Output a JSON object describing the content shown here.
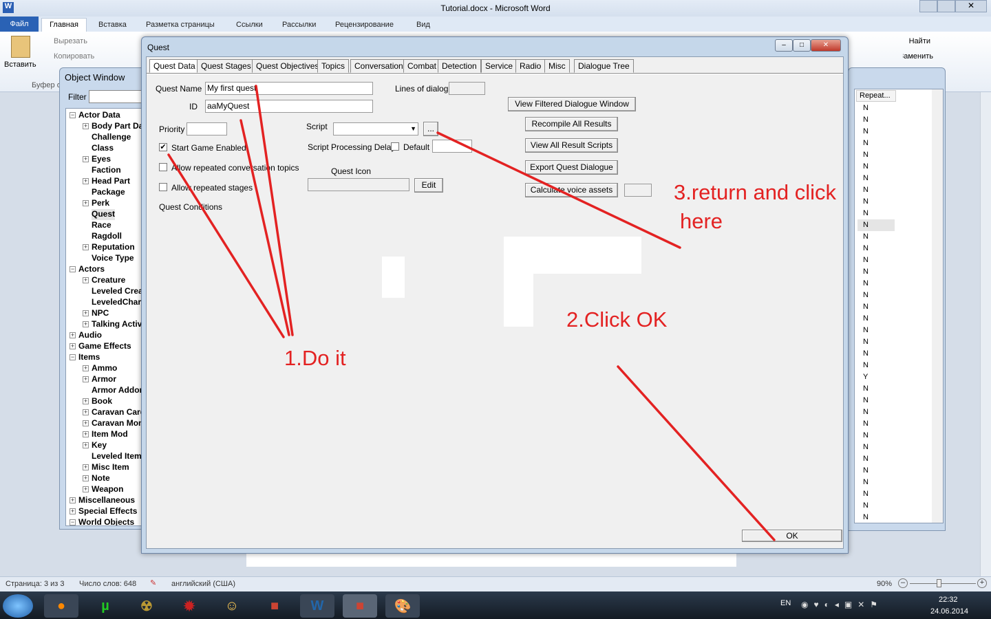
{
  "word": {
    "title": "Tutorial.docx - Microsoft Word",
    "file_tab": "Файл",
    "tabs": [
      "Главная",
      "Вставка",
      "Разметка страницы",
      "Ссылки",
      "Рассылки",
      "Рецензирование",
      "Вид"
    ],
    "clipboard": {
      "paste": "Вставить",
      "cut": "Вырезать",
      "copy": "Копировать",
      "group": "Буфер обмена"
    },
    "find": "Найти",
    "replace": "Заменить",
    "status": {
      "page": "Страница: 3 из 3",
      "words": "Число слов: 648",
      "language": "английский (США)",
      "zoom": "90%"
    }
  },
  "object_window": {
    "title": "Object Window",
    "filter_label": "Filter",
    "tree": [
      {
        "label": "Actor Data",
        "level": 0,
        "expander": "minus"
      },
      {
        "label": "Body Part Data",
        "level": 1,
        "expander": "plus"
      },
      {
        "label": "Challenge",
        "level": 1,
        "expander": ""
      },
      {
        "label": "Class",
        "level": 1,
        "expander": ""
      },
      {
        "label": "Eyes",
        "level": 1,
        "expander": "plus"
      },
      {
        "label": "Faction",
        "level": 1,
        "expander": ""
      },
      {
        "label": "Head Part",
        "level": 1,
        "expander": "plus"
      },
      {
        "label": "Package",
        "level": 1,
        "expander": ""
      },
      {
        "label": "Perk",
        "level": 1,
        "expander": "plus"
      },
      {
        "label": "Quest",
        "level": 1,
        "expander": "",
        "selected": true
      },
      {
        "label": "Race",
        "level": 1,
        "expander": ""
      },
      {
        "label": "Ragdoll",
        "level": 1,
        "expander": ""
      },
      {
        "label": "Reputation",
        "level": 1,
        "expander": "plus"
      },
      {
        "label": "Voice Type",
        "level": 1,
        "expander": ""
      },
      {
        "label": "Actors",
        "level": 0,
        "expander": "minus"
      },
      {
        "label": "Creature",
        "level": 1,
        "expander": "plus"
      },
      {
        "label": "Leveled Creature",
        "level": 1,
        "expander": ""
      },
      {
        "label": "LeveledCharacter",
        "level": 1,
        "expander": ""
      },
      {
        "label": "NPC",
        "level": 1,
        "expander": "plus"
      },
      {
        "label": "Talking Activator",
        "level": 1,
        "expander": "plus"
      },
      {
        "label": "Audio",
        "level": 0,
        "expander": "plus"
      },
      {
        "label": "Game Effects",
        "level": 0,
        "expander": "plus"
      },
      {
        "label": "Items",
        "level": 0,
        "expander": "minus"
      },
      {
        "label": "Ammo",
        "level": 1,
        "expander": "plus"
      },
      {
        "label": "Armor",
        "level": 1,
        "expander": "plus"
      },
      {
        "label": "Armor Addon",
        "level": 1,
        "expander": ""
      },
      {
        "label": "Book",
        "level": 1,
        "expander": "plus"
      },
      {
        "label": "Caravan Card",
        "level": 1,
        "expander": "plus"
      },
      {
        "label": "Caravan Money",
        "level": 1,
        "expander": "plus"
      },
      {
        "label": "Item Mod",
        "level": 1,
        "expander": "plus"
      },
      {
        "label": "Key",
        "level": 1,
        "expander": "plus"
      },
      {
        "label": "Leveled Item",
        "level": 1,
        "expander": ""
      },
      {
        "label": "Misc Item",
        "level": 1,
        "expander": "plus"
      },
      {
        "label": "Note",
        "level": 1,
        "expander": "plus"
      },
      {
        "label": "Weapon",
        "level": 1,
        "expander": "plus"
      },
      {
        "label": "Miscellaneous",
        "level": 0,
        "expander": "plus"
      },
      {
        "label": "Special Effects",
        "level": 0,
        "expander": "plus"
      },
      {
        "label": "World Objects",
        "level": 0,
        "expander": "minus"
      }
    ]
  },
  "right_list": {
    "column": "Repeat...",
    "values": [
      "N",
      "N",
      "N",
      "N",
      "N",
      "N",
      "N",
      "N",
      "N",
      "N",
      "N",
      "N",
      "N",
      "N",
      "N",
      "N",
      "N",
      "N",
      "N",
      "N",
      "N",
      "N",
      "N",
      "Y",
      "N",
      "N",
      "N",
      "N",
      "N",
      "N",
      "N",
      "N",
      "N",
      "N",
      "N",
      "N"
    ]
  },
  "quest": {
    "title": "Quest",
    "tabs": [
      "Quest Data",
      "Quest Stages",
      "Quest Objectives",
      "Topics",
      "Conversation",
      "Combat",
      "Detection",
      "Service",
      "Radio",
      "Misc",
      "Dialogue Tree"
    ],
    "active_tab": "Quest Data",
    "quest_name_label": "Quest Name",
    "quest_name": "My first quest",
    "id_label": "ID",
    "id": "aaMyQuest",
    "priority_label": "Priority",
    "priority": "",
    "start_game_enabled": {
      "label": "Start Game Enabled",
      "checked": true
    },
    "allow_repeated_topics": {
      "label": "Allow repeated conversation topics",
      "checked": false
    },
    "allow_repeated_stages": {
      "label": "Allow repeated stages",
      "checked": false
    },
    "conditions_label": "Quest Conditions",
    "script_label": "Script",
    "script": "",
    "browse": "...",
    "delay_label": "Script Processing Delay",
    "default_label": "Default",
    "default_checked": false,
    "quest_icon_label": "Quest Icon",
    "edit": "Edit",
    "lines_label": "Lines of dialog:",
    "buttons": [
      "View Filtered Dialogue Window",
      "Recompile All Results",
      "View All Result Scripts",
      "Export Quest Dialogue",
      "Calculate voice assets"
    ],
    "ok": "OK"
  },
  "annotations": {
    "step1": "1.Do it",
    "step2": "2.Click OK",
    "step3a": "3.return and click",
    "step3b": "here",
    "color": "#e32222"
  },
  "taskbar": {
    "lang": "EN",
    "time": "22:32",
    "date": "24.06.2014"
  }
}
